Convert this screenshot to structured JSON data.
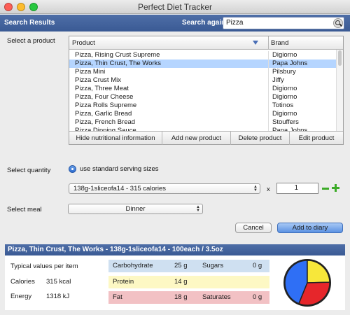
{
  "window": {
    "title": "Perfect Diet Tracker"
  },
  "header": {
    "title": "Search Results",
    "search_again_label": "Search again",
    "search_value": "Pizza"
  },
  "product": {
    "label": "Select a product",
    "col_product": "Product",
    "col_brand": "Brand",
    "rows": [
      {
        "name": "Pizza, Rising Crust Supreme",
        "brand": "Digiorno"
      },
      {
        "name": "Pizza, Thin Crust, The Works",
        "brand": "Papa Johns"
      },
      {
        "name": "Pizza Mini",
        "brand": "Pilsbury"
      },
      {
        "name": "Pizza Crust Mix",
        "brand": "Jiffy"
      },
      {
        "name": "Pizza, Three Meat",
        "brand": "Digiorno"
      },
      {
        "name": "Pizza, Four Cheese",
        "brand": "Digiorno"
      },
      {
        "name": "Pizza Rolls Supreme",
        "brand": "Totinos"
      },
      {
        "name": "Pizza,  Garlic Bread",
        "brand": "Digiorno"
      },
      {
        "name": "Pizza, French Bread",
        "brand": "Stouffers"
      },
      {
        "name": "Pizza Dipping Sauce",
        "brand": "Papa Johns"
      },
      {
        "name": "Pizza, Focaccia Supreme",
        "brand": "Digiorno"
      }
    ],
    "selected_index": 1,
    "buttons": {
      "hide": "Hide nutritional information",
      "add": "Add new product",
      "delete": "Delete product",
      "edit": "Edit product"
    }
  },
  "quantity": {
    "label": "Select quantity",
    "radio_label": "use standard serving sizes",
    "serving": "138g-1sliceofa14 - 315 calories",
    "times": "x",
    "value": "1"
  },
  "meal": {
    "label": "Select meal",
    "value": "Dinner"
  },
  "actions": {
    "cancel": "Cancel",
    "add": "Add to diary"
  },
  "nutrition": {
    "title": "Pizza, Thin Crust, The Works - 138g-1sliceofa14 - 100each / 3.5oz",
    "typical": "Typical values per item",
    "calories_label": "Calories",
    "calories_value": "315 kcal",
    "energy_label": "Energy",
    "energy_value": "1318 kJ",
    "carb_label": "Carbohydrate",
    "carb_value": "25 g",
    "sugars_label": "Sugars",
    "sugars_value": "0 g",
    "protein_label": "Protein",
    "protein_value": "14 g",
    "fat_label": "Fat",
    "fat_value": "18 g",
    "saturates_label": "Saturates",
    "saturates_value": "0 g",
    "pie_colors": {
      "carbohydrate": "#2f6ff5",
      "protein": "#f7e73a",
      "fat": "#e6262b"
    }
  }
}
